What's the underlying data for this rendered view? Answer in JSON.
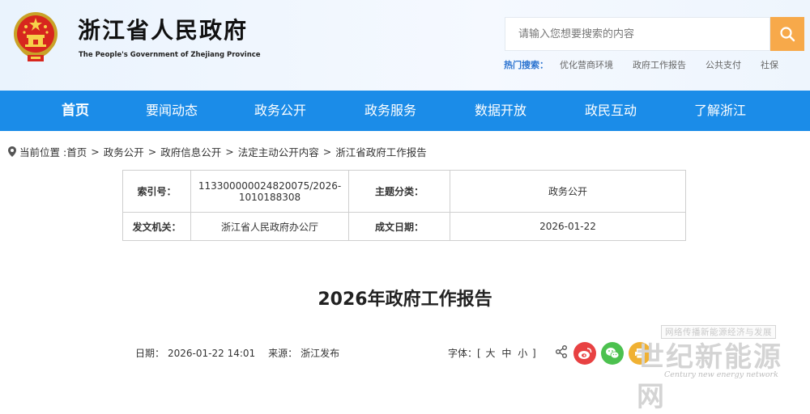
{
  "header": {
    "title": "浙江省人民政府",
    "subtitle": "The People's Government of Zhejiang Province"
  },
  "search": {
    "placeholder": "请输入您想要搜索的内容",
    "hot_label": "热门搜索：",
    "hot_items": [
      "优化营商环境",
      "政府工作报告",
      "公共支付",
      "社保"
    ]
  },
  "nav": {
    "items": [
      "首页",
      "要闻动态",
      "政务公开",
      "政务服务",
      "数据开放",
      "政民互动",
      "了解浙江"
    ]
  },
  "breadcrumb": {
    "prefix": "当前位置 :",
    "items": [
      "首页",
      "政务公开",
      "政府信息公开",
      "法定主动公开内容",
      "浙江省政府工作报告"
    ]
  },
  "meta": {
    "index_label": "索引号：",
    "index_value_line1": "113300000024820075/2026-",
    "index_value_line2": "1010188308",
    "topic_label": "主题分类：",
    "topic_value": "政务公开",
    "issuer_label": "发文机关：",
    "issuer_value": "浙江省人民政府办公厅",
    "date_label": "成文日期：",
    "date_value": "2026-01-22"
  },
  "article": {
    "title": "2026年政府工作报告",
    "date_label": "日期：",
    "date_value": "2026-01-22 14:01",
    "source_label": "来源：",
    "source_value": "浙江发布",
    "font_label": "字体：[",
    "font_large": "大",
    "font_medium": "中",
    "font_small": "小",
    "font_close": "]"
  },
  "watermark": {
    "box": "网络传播新能源经济与发展",
    "big": "世纪新能源网",
    "small": "Century new energy network"
  },
  "colors": {
    "nav_blue": "#1b8ce8",
    "search_orange": "#f7a94a",
    "hot_blue": "#2b73d0",
    "weibo_red": "#e84142",
    "wechat_green": "#4cc14f",
    "print_yellow": "#f0b133"
  },
  "icons": [
    "national-emblem-icon",
    "search-icon",
    "location-pin-icon",
    "share-icon",
    "weibo-icon",
    "wechat-icon",
    "print-icon"
  ]
}
